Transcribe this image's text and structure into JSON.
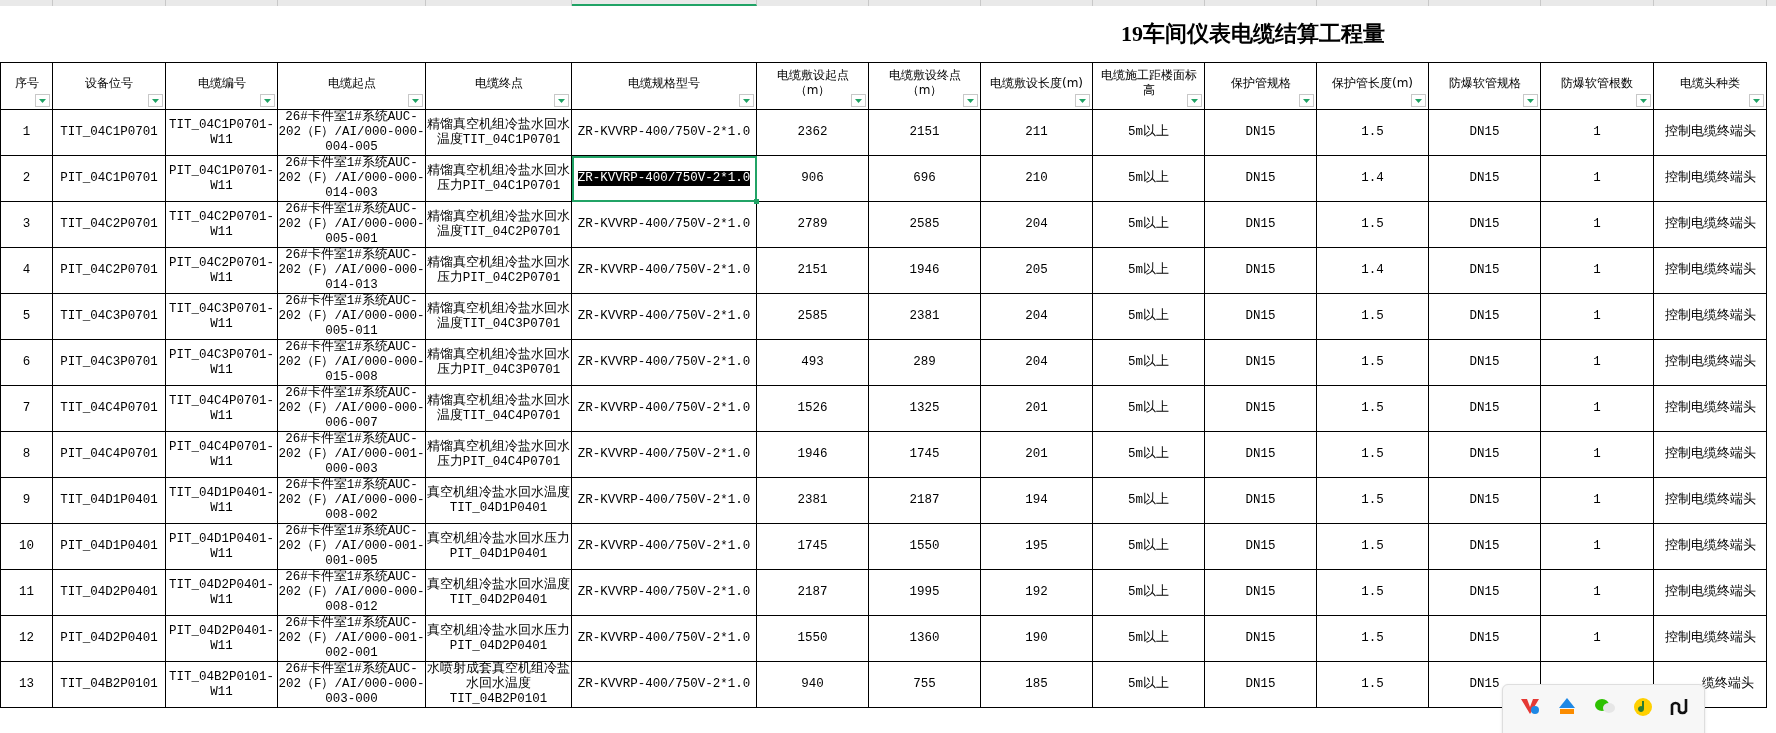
{
  "title": "19车间仪表电缆结算工程量",
  "columns": [
    "序号",
    "设备位号",
    "电缆编号",
    "电缆起点",
    "电缆终点",
    "电缆规格型号",
    "电缆敷设起点（m）",
    "电缆敷设终点（m）",
    "电缆敷设长度(m)",
    "电缆施工距楼面标高",
    "保护管规格",
    "保护管长度(m)",
    "防爆软管规格",
    "防爆软管根数",
    "电缆头种类"
  ],
  "rows": [
    {
      "selected": false,
      "cells": [
        "1",
        "TIT_04C1P0701",
        "TIT_04C1P0701-W11",
        "26#卡件室1#系统AUC-202（F）/AI/000-000-004-005",
        "精馏真空机组冷盐水回水温度TIT_04C1P0701",
        "ZR-KVVRP-400/750V-2*1.0",
        "2362",
        "2151",
        "211",
        "5m以上",
        "DN15",
        "1.5",
        "DN15",
        "1",
        "控制电缆终端头"
      ]
    },
    {
      "selected": true,
      "cells": [
        "2",
        "PIT_04C1P0701",
        "PIT_04C1P0701-W11",
        "26#卡件室1#系统AUC-202（F）/AI/000-000-014-003",
        "精馏真空机组冷盐水回水压力PIT_04C1P0701",
        "ZR-KVVRP-400/750V-2*1.0",
        "906",
        "696",
        "210",
        "5m以上",
        "DN15",
        "1.4",
        "DN15",
        "1",
        "控制电缆终端头"
      ]
    },
    {
      "selected": false,
      "cells": [
        "3",
        "TIT_04C2P0701",
        "TIT_04C2P0701-W11",
        "26#卡件室1#系统AUC-202（F）/AI/000-000-005-001",
        "精馏真空机组冷盐水回水温度TIT_04C2P0701",
        "ZR-KVVRP-400/750V-2*1.0",
        "2789",
        "2585",
        "204",
        "5m以上",
        "DN15",
        "1.5",
        "DN15",
        "1",
        "控制电缆终端头"
      ]
    },
    {
      "selected": false,
      "cells": [
        "4",
        "PIT_04C2P0701",
        "PIT_04C2P0701-W11",
        "26#卡件室1#系统AUC-202（F）/AI/000-000-014-013",
        "精馏真空机组冷盐水回水压力PIT_04C2P0701",
        "ZR-KVVRP-400/750V-2*1.0",
        "2151",
        "1946",
        "205",
        "5m以上",
        "DN15",
        "1.4",
        "DN15",
        "1",
        "控制电缆终端头"
      ]
    },
    {
      "selected": false,
      "cells": [
        "5",
        "TIT_04C3P0701",
        "TIT_04C3P0701-W11",
        "26#卡件室1#系统AUC-202（F）/AI/000-000-005-011",
        "精馏真空机组冷盐水回水温度TIT_04C3P0701",
        "ZR-KVVRP-400/750V-2*1.0",
        "2585",
        "2381",
        "204",
        "5m以上",
        "DN15",
        "1.5",
        "DN15",
        "1",
        "控制电缆终端头"
      ]
    },
    {
      "selected": false,
      "cells": [
        "6",
        "PIT_04C3P0701",
        "PIT_04C3P0701-W11",
        "26#卡件室1#系统AUC-202（F）/AI/000-000-015-008",
        "精馏真空机组冷盐水回水压力PIT_04C3P0701",
        "ZR-KVVRP-400/750V-2*1.0",
        "493",
        "289",
        "204",
        "5m以上",
        "DN15",
        "1.5",
        "DN15",
        "1",
        "控制电缆终端头"
      ]
    },
    {
      "selected": false,
      "cells": [
        "7",
        "TIT_04C4P0701",
        "TIT_04C4P0701-W11",
        "26#卡件室1#系统AUC-202（F）/AI/000-000-006-007",
        "精馏真空机组冷盐水回水温度TIT_04C4P0701",
        "ZR-KVVRP-400/750V-2*1.0",
        "1526",
        "1325",
        "201",
        "5m以上",
        "DN15",
        "1.5",
        "DN15",
        "1",
        "控制电缆终端头"
      ]
    },
    {
      "selected": false,
      "cells": [
        "8",
        "PIT_04C4P0701",
        "PIT_04C4P0701-W11",
        "26#卡件室1#系统AUC-202（F）/AI/000-001-000-003",
        "精馏真空机组冷盐水回水压力PIT_04C4P0701",
        "ZR-KVVRP-400/750V-2*1.0",
        "1946",
        "1745",
        "201",
        "5m以上",
        "DN15",
        "1.5",
        "DN15",
        "1",
        "控制电缆终端头"
      ]
    },
    {
      "selected": false,
      "cells": [
        "9",
        "TIT_04D1P0401",
        "TIT_04D1P0401-W11",
        "26#卡件室1#系统AUC-202（F）/AI/000-000-008-002",
        "真空机组冷盐水回水温度TIT_04D1P0401",
        "ZR-KVVRP-400/750V-2*1.0",
        "2381",
        "2187",
        "194",
        "5m以上",
        "DN15",
        "1.5",
        "DN15",
        "1",
        "控制电缆终端头"
      ]
    },
    {
      "selected": false,
      "cells": [
        "10",
        "PIT_04D1P0401",
        "PIT_04D1P0401-W11",
        "26#卡件室1#系统AUC-202（F）/AI/000-001-001-005",
        "真空机组冷盐水回水压力PIT_04D1P0401",
        "ZR-KVVRP-400/750V-2*1.0",
        "1745",
        "1550",
        "195",
        "5m以上",
        "DN15",
        "1.5",
        "DN15",
        "1",
        "控制电缆终端头"
      ]
    },
    {
      "selected": false,
      "cells": [
        "11",
        "TIT_04D2P0401",
        "TIT_04D2P0401-W11",
        "26#卡件室1#系统AUC-202（F）/AI/000-000-008-012",
        "真空机组冷盐水回水温度TIT_04D2P0401",
        "ZR-KVVRP-400/750V-2*1.0",
        "2187",
        "1995",
        "192",
        "5m以上",
        "DN15",
        "1.5",
        "DN15",
        "1",
        "控制电缆终端头"
      ]
    },
    {
      "selected": false,
      "cells": [
        "12",
        "PIT_04D2P0401",
        "PIT_04D2P0401-W11",
        "26#卡件室1#系统AUC-202（F）/AI/000-001-002-001",
        "真空机组冷盐水回水压力PIT_04D2P0401",
        "ZR-KVVRP-400/750V-2*1.0",
        "1550",
        "1360",
        "190",
        "5m以上",
        "DN15",
        "1.5",
        "DN15",
        "1",
        "控制电缆终端头"
      ]
    },
    {
      "selected": false,
      "cells": [
        "13",
        "TIT_04B2P0101",
        "TIT_04B2P0101-W11",
        "26#卡件室1#系统AUC-202（F）/AI/000-000-003-000",
        "水喷射成套真空机组冷盐水回水温度TIT_04B2P0101",
        "ZR-KVVRP-400/750V-2*1.0",
        "940",
        "755",
        "185",
        "5m以上",
        "DN15",
        "1.5",
        "DN15",
        null,
        "缆终端头"
      ]
    }
  ]
}
